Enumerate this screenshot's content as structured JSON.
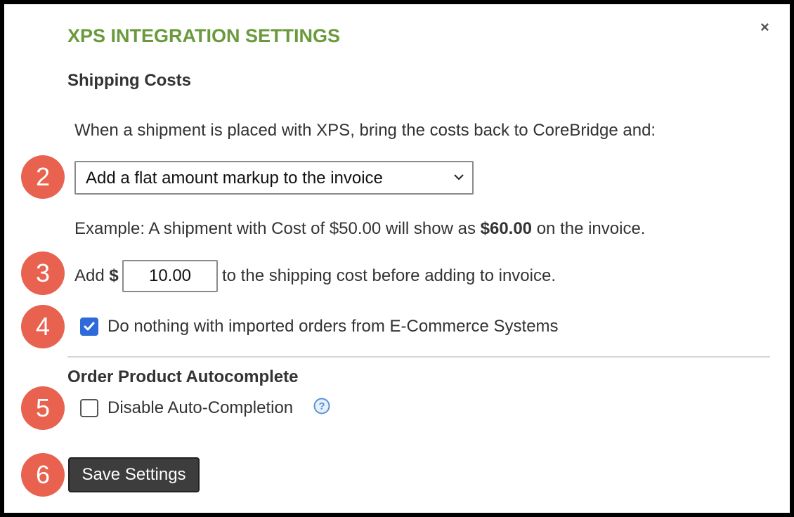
{
  "dialog": {
    "title": "XPS INTEGRATION SETTINGS",
    "close_label": "×"
  },
  "shipping_costs": {
    "heading": "Shipping Costs",
    "intro": "When a shipment is placed with XPS, bring the costs back to CoreBridge and:",
    "mode_select": {
      "value": "Add a flat amount markup to the invoice"
    },
    "example": {
      "prefix": "Example: A shipment with Cost of $50.00 will show as ",
      "amount": "$60.00",
      "suffix": " on the invoice."
    },
    "markup": {
      "prefix": "Add ",
      "currency": "$",
      "value": "10.00",
      "suffix": "to the shipping cost before adding to invoice."
    },
    "ecommerce_option": {
      "label": "Do nothing with imported orders from E-Commerce Systems",
      "checked": true
    }
  },
  "autocomplete": {
    "heading": "Order Product Autocomplete",
    "disable_option": {
      "label": "Disable Auto-Completion",
      "checked": false
    },
    "help_icon": "question-circle-icon"
  },
  "actions": {
    "save_label": "Save Settings"
  },
  "step_markers": [
    "2",
    "3",
    "4",
    "5",
    "6"
  ],
  "colors": {
    "title": "#6a9a3c",
    "marker": "#e8624f",
    "checkbox_checked": "#2f6bd8",
    "save_button": "#3d3d3d",
    "help_icon": "#5b93d6"
  }
}
